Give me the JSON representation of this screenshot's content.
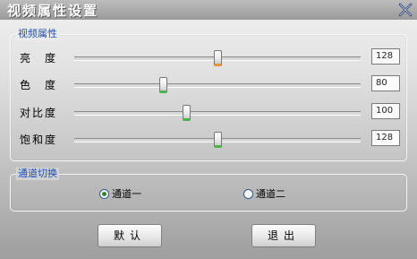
{
  "window": {
    "title": "视频属性设置"
  },
  "video_group": {
    "title": "视频属性",
    "sliders": [
      {
        "label": "亮　度",
        "value": "128",
        "fraction": 0.5
      },
      {
        "label": "色　度",
        "value": "80",
        "fraction": 0.31
      },
      {
        "label": "对比度",
        "value": "100",
        "fraction": 0.39
      },
      {
        "label": "饱和度",
        "value": "128",
        "fraction": 0.5
      }
    ]
  },
  "channel_group": {
    "title": "通道切换",
    "options": [
      {
        "label": "通道一",
        "checked": true
      },
      {
        "label": "通道二",
        "checked": false
      }
    ]
  },
  "buttons": {
    "default_label": "默认",
    "exit_label": "退出"
  },
  "colors": {
    "accent_title": "#1f4fb5",
    "thumb_green": "#46b84a",
    "thumb_orange": "#e0963c"
  }
}
